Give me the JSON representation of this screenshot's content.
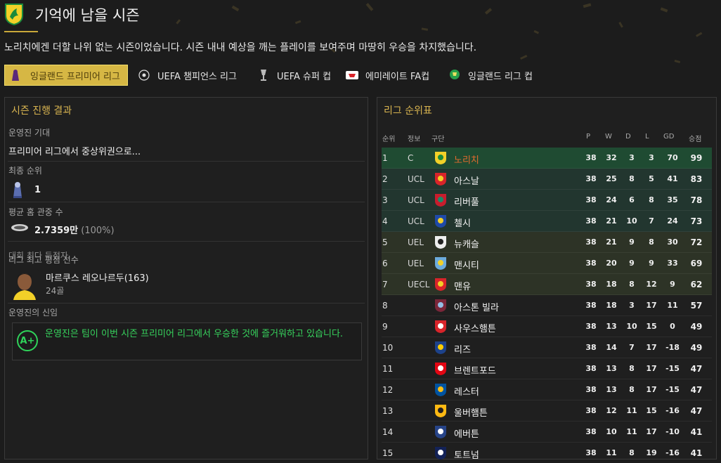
{
  "header": {
    "title": "기억에 남을 시즌",
    "subtitle": "노리치에겐 더할 나위 없는 시즌이었습니다. 시즌 내내 예상을 깨는 플레이를 보여주며 마땅히 우승을 차지했습니다."
  },
  "tabs": [
    {
      "label": "잉글랜드 프리미어 리그",
      "icon": "premier-league-icon",
      "active": true
    },
    {
      "label": "UEFA 챔피언스 리그",
      "icon": "champions-league-icon",
      "active": false
    },
    {
      "label": "UEFA 슈퍼 컵",
      "icon": "super-cup-icon",
      "active": false
    },
    {
      "label": "에미레이트 FA컵",
      "icon": "fa-cup-icon",
      "active": false
    },
    {
      "label": "잉글랜드 리그 컵",
      "icon": "league-cup-icon",
      "active": false
    }
  ],
  "season_panel": {
    "title": "시즌 진행 결과",
    "board_expectation_label": "운영진 기대",
    "board_expectation_value": "프리미어 리그에서 중상위권으로...",
    "final_position_label": "최종 순위",
    "final_position_value": "1",
    "avg_attendance_label": "평균 홈 관중 수",
    "avg_attendance_value": "2.7359만",
    "avg_attendance_pct": "(100%)",
    "top_scorer_label": "대회 최다 득점자",
    "top_rated_label": "리그 최고 평점 선수",
    "player_name": "마르쿠스 레오나르두(163)",
    "player_goals": "24골",
    "board_confidence_label": "운영진의 신임",
    "board_confidence_grade": "A+",
    "board_confidence_text": "운영진은 팀이 이번 시즌 프리미어 리그에서 우승한 것에 즐거워하고 있습니다."
  },
  "league_table": {
    "title": "리그 순위표",
    "columns": {
      "pos": "순위",
      "info": "정보",
      "team": "구단",
      "p": "P",
      "w": "W",
      "d": "D",
      "l": "L",
      "gd": "GD",
      "pts": "승점"
    },
    "rows": [
      {
        "pos": "1",
        "info": "C",
        "team": "노리치",
        "p": "38",
        "w": "32",
        "d": "3",
        "l": "3",
        "gd": "70",
        "pts": "99",
        "zone": "champ",
        "crest": "#f2d028",
        "crest2": "#1a8a3c"
      },
      {
        "pos": "2",
        "info": "UCL",
        "team": "아스날",
        "p": "38",
        "w": "25",
        "d": "8",
        "l": "5",
        "gd": "41",
        "pts": "83",
        "zone": "ucl",
        "crest": "#d8242a",
        "crest2": "#f2d028"
      },
      {
        "pos": "3",
        "info": "UCL",
        "team": "리버풀",
        "p": "38",
        "w": "24",
        "d": "6",
        "l": "8",
        "gd": "35",
        "pts": "78",
        "zone": "ucl",
        "crest": "#c81d2d",
        "crest2": "#1a8a6a"
      },
      {
        "pos": "4",
        "info": "UCL",
        "team": "첼시",
        "p": "38",
        "w": "21",
        "d": "10",
        "l": "7",
        "gd": "24",
        "pts": "73",
        "zone": "ucl",
        "crest": "#1f4aa8",
        "crest2": "#f2d028"
      },
      {
        "pos": "5",
        "info": "UEL",
        "team": "뉴캐슬",
        "p": "38",
        "w": "21",
        "d": "9",
        "l": "8",
        "gd": "30",
        "pts": "72",
        "zone": "uel",
        "crest": "#eeeeee",
        "crest2": "#222222"
      },
      {
        "pos": "6",
        "info": "UEL",
        "team": "맨시티",
        "p": "38",
        "w": "20",
        "d": "9",
        "l": "9",
        "gd": "33",
        "pts": "69",
        "zone": "uel",
        "crest": "#6cabdd",
        "crest2": "#f2d028"
      },
      {
        "pos": "7",
        "info": "UECL",
        "team": "맨유",
        "p": "38",
        "w": "18",
        "d": "8",
        "l": "12",
        "gd": "9",
        "pts": "62",
        "zone": "uel",
        "crest": "#d8242a",
        "crest2": "#f2d028"
      },
      {
        "pos": "8",
        "info": "",
        "team": "아스톤 빌라",
        "p": "38",
        "w": "18",
        "d": "3",
        "l": "17",
        "gd": "11",
        "pts": "57",
        "zone": "",
        "crest": "#7a2639",
        "crest2": "#94bee5"
      },
      {
        "pos": "9",
        "info": "",
        "team": "사우스햄튼",
        "p": "38",
        "w": "13",
        "d": "10",
        "l": "15",
        "gd": "0",
        "pts": "49",
        "zone": "",
        "crest": "#d8242a",
        "crest2": "#ffffff"
      },
      {
        "pos": "10",
        "info": "",
        "team": "리즈",
        "p": "38",
        "w": "14",
        "d": "7",
        "l": "17",
        "gd": "-18",
        "pts": "49",
        "zone": "",
        "crest": "#1d428a",
        "crest2": "#ffcd00"
      },
      {
        "pos": "11",
        "info": "",
        "team": "브렌트포드",
        "p": "38",
        "w": "13",
        "d": "8",
        "l": "17",
        "gd": "-15",
        "pts": "47",
        "zone": "",
        "crest": "#e30613",
        "crest2": "#ffffff"
      },
      {
        "pos": "12",
        "info": "",
        "team": "레스터",
        "p": "38",
        "w": "13",
        "d": "8",
        "l": "17",
        "gd": "-15",
        "pts": "47",
        "zone": "",
        "crest": "#0053a0",
        "crest2": "#fdbe11"
      },
      {
        "pos": "13",
        "info": "",
        "team": "울버햄튼",
        "p": "38",
        "w": "12",
        "d": "11",
        "l": "15",
        "gd": "-16",
        "pts": "47",
        "zone": "",
        "crest": "#fdb913",
        "crest2": "#231f20"
      },
      {
        "pos": "14",
        "info": "",
        "team": "에버튼",
        "p": "38",
        "w": "10",
        "d": "11",
        "l": "17",
        "gd": "-10",
        "pts": "41",
        "zone": "",
        "crest": "#274488",
        "crest2": "#ffffff"
      },
      {
        "pos": "15",
        "info": "",
        "team": "토트넘",
        "p": "38",
        "w": "11",
        "d": "8",
        "l": "19",
        "gd": "-16",
        "pts": "41",
        "zone": "",
        "crest": "#132257",
        "crest2": "#ffffff"
      }
    ]
  },
  "colors": {
    "accent": "#d6b744",
    "positive": "#2fd35a",
    "highlight": "#e16b2e",
    "ucl_zone": "#22362f",
    "uel_zone": "#2d3326",
    "champ_zone": "#1f4b32"
  }
}
